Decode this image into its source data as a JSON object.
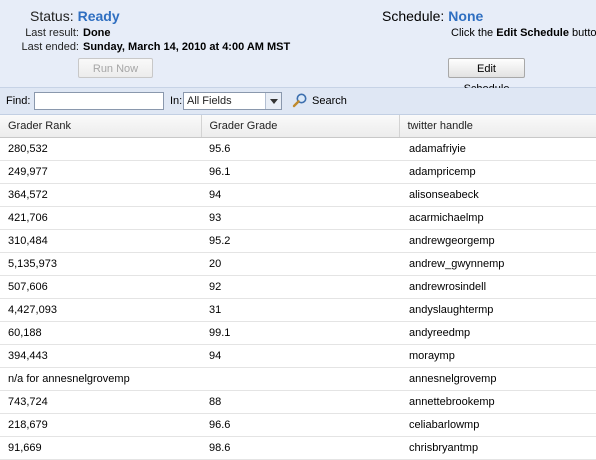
{
  "status": {
    "label": "Status:",
    "value": "Ready",
    "last_result_label": "Last result:",
    "last_result_value": "Done",
    "last_ended_label": "Last ended:",
    "last_ended_value": "Sunday, March 14, 2010 at 4:00 AM MST",
    "run_now_label": "Run Now"
  },
  "schedule": {
    "label": "Schedule:",
    "value": "None",
    "hint_prefix": "Click the ",
    "hint_bold": "Edit Schedule",
    "hint_suffix": " butto",
    "edit_label": "Edit Schedule"
  },
  "find": {
    "find_label": "Find:",
    "find_value": "",
    "in_label": "In:",
    "in_selected": "All Fields",
    "search_label": "Search",
    "search_icon": "magnifier-icon"
  },
  "colors": {
    "accent": "#2f6fc1",
    "header_bg": "#e7edf8",
    "toolbar_bg": "#dfe7f4"
  },
  "table": {
    "columns": [
      "Grader Rank",
      "Grader Grade",
      "twitter handle"
    ],
    "rows": [
      [
        "280,532",
        "95.6",
        "adamafriyie"
      ],
      [
        "249,977",
        "96.1",
        "adampricemp"
      ],
      [
        "364,572",
        "94",
        "alisonseabeck"
      ],
      [
        "421,706",
        "93",
        "acarmichaelmp"
      ],
      [
        "310,484",
        "95.2",
        "andrewgeorgemp"
      ],
      [
        "5,135,973",
        "20",
        "andrew_gwynnemp"
      ],
      [
        "507,606",
        "92",
        "andrewrosindell"
      ],
      [
        "4,427,093",
        "31",
        "andyslaughtermp"
      ],
      [
        "60,188",
        "99.1",
        "andyreedmp"
      ],
      [
        "394,443",
        "94",
        "moraymp"
      ],
      [
        "n/a for annesnelgrovemp",
        "",
        "annesnelgrovemp"
      ],
      [
        "743,724",
        "88",
        "annettebrookemp"
      ],
      [
        "218,679",
        "96.6",
        "celiabarlowmp"
      ],
      [
        "91,669",
        "98.6",
        "chrisbryantmp"
      ]
    ]
  }
}
